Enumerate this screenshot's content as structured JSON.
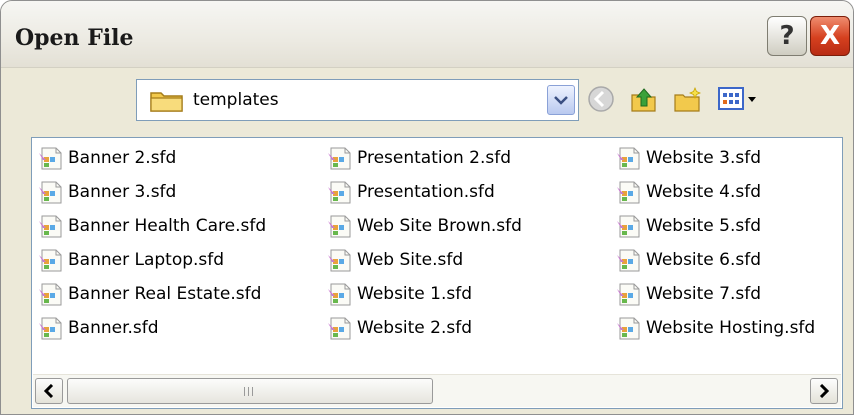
{
  "window": {
    "title": "Open File",
    "help_label": "?",
    "close_label": "X"
  },
  "toolbar": {
    "location": "templates",
    "location_icon": "folder-icon",
    "dropdown_icon": "chevron-down-icon",
    "buttons": [
      "back-icon",
      "up-folder-icon",
      "new-folder-icon",
      "view-menu-icon"
    ]
  },
  "files": {
    "columns": [
      [
        "Banner 2.sfd",
        "Banner 3.sfd",
        "Banner Health Care.sfd",
        "Banner Laptop.sfd",
        "Banner Real Estate.sfd",
        "Banner.sfd"
      ],
      [
        "Presentation 2.sfd",
        "Presentation.sfd",
        "Web Site Brown.sfd",
        "Web Site.sfd",
        "Website 1.sfd",
        "Website 2.sfd"
      ],
      [
        "Website 3.sfd",
        "Website 4.sfd",
        "Website 5.sfd",
        "Website 6.sfd",
        "Website 7.sfd",
        "Website Hosting.sfd"
      ]
    ],
    "file_icon": "sfd-file-icon"
  },
  "scrollbar": {
    "left_icon": "arrow-left-icon",
    "right_icon": "arrow-right-icon"
  },
  "colors": {
    "window_bg": "#ece9d8",
    "border_blue": "#7f9db9",
    "close_red": "#d5401f"
  }
}
